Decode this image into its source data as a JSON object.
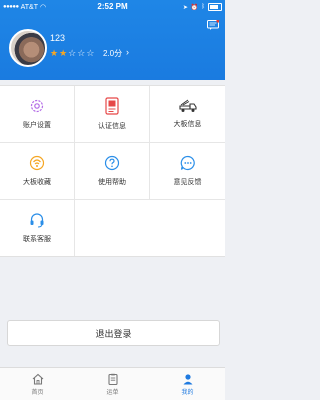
{
  "status": {
    "carrier": "AT&T",
    "time": "2:52 PM"
  },
  "profile": {
    "username": "123",
    "stars_filled": 2,
    "stars_total": 5,
    "score": "2.0分"
  },
  "grid": {
    "items": [
      {
        "label": "账户设置",
        "icon": "gear-icon",
        "color": "#b36be6"
      },
      {
        "label": "认证信息",
        "icon": "id-card-icon",
        "color": "#e64848"
      },
      {
        "label": "大板信息",
        "icon": "truck-icon",
        "color": "#333333"
      },
      {
        "label": "大板收藏",
        "icon": "favorite-icon",
        "color": "#f5a623"
      },
      {
        "label": "使用帮助",
        "icon": "help-icon",
        "color": "#2a8ee8"
      },
      {
        "label": "意见反馈",
        "icon": "feedback-icon",
        "color": "#2a8ee8"
      },
      {
        "label": "联系客服",
        "icon": "headset-icon",
        "color": "#2a8ee8"
      }
    ]
  },
  "logout": {
    "label": "退出登录"
  },
  "tabs": [
    {
      "label": "首页",
      "icon": "home-icon",
      "active": false
    },
    {
      "label": "运单",
      "icon": "clipboard-icon",
      "active": false
    },
    {
      "label": "我的",
      "icon": "user-icon",
      "active": true
    }
  ]
}
